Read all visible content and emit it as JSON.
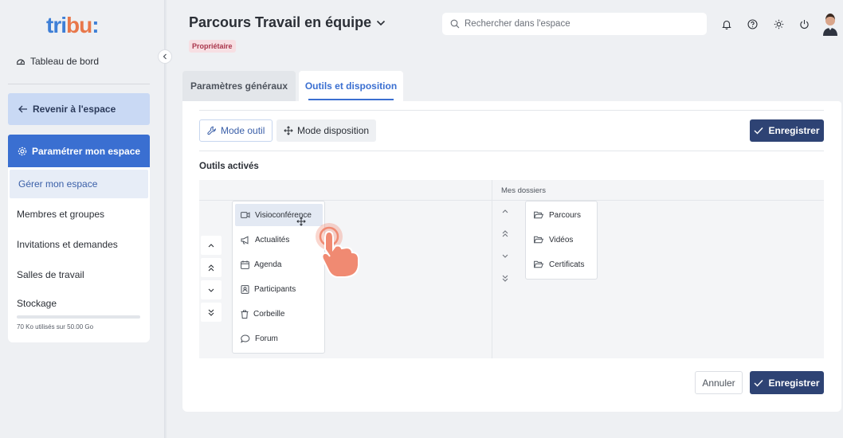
{
  "logo": {
    "part1": "tri",
    "part2": "bu",
    "part3": ":"
  },
  "sidebar": {
    "dashboard_label": "Tableau de bord",
    "back_label": "Revenir à l'espace",
    "settings_label": "Paramétrer mon espace",
    "items": [
      {
        "label": "Gérer mon espace"
      },
      {
        "label": "Membres et groupes"
      },
      {
        "label": "Invitations et demandes"
      },
      {
        "label": "Salles de travail"
      },
      {
        "label": "Stockage"
      }
    ],
    "storage_text": "70 Ko utilisés sur 50.00 Go"
  },
  "header": {
    "title": "Parcours Travail en équipe",
    "badge": "Propriétaire",
    "search_placeholder": "Rechercher dans l'espace"
  },
  "tabs": [
    {
      "label": "Paramètres généraux"
    },
    {
      "label": "Outils et disposition"
    }
  ],
  "toolbar": {
    "mode_tool": "Mode outil",
    "mode_layout": "Mode disposition",
    "save": "Enregistrer"
  },
  "section": {
    "title": "Outils activés",
    "folders_label": "Mes dossiers"
  },
  "tools": [
    {
      "label": "Visioconférence",
      "icon": "video-icon"
    },
    {
      "label": "Actualités",
      "icon": "megaphone-icon"
    },
    {
      "label": "Agenda",
      "icon": "calendar-icon"
    },
    {
      "label": "Participants",
      "icon": "contacts-icon"
    },
    {
      "label": "Corbeille",
      "icon": "trash-icon"
    },
    {
      "label": "Forum",
      "icon": "chat-icon"
    }
  ],
  "folders": [
    {
      "label": "Parcours"
    },
    {
      "label": "Vidéos"
    },
    {
      "label": "Certificats"
    }
  ],
  "footer": {
    "cancel": "Annuler",
    "save": "Enregistrer"
  },
  "colors": {
    "primary": "#3a6fd1",
    "navy": "#2e4374",
    "badge_bg": "#f7dfe3",
    "badge_text": "#a9364c",
    "hand": "#f08a72"
  }
}
